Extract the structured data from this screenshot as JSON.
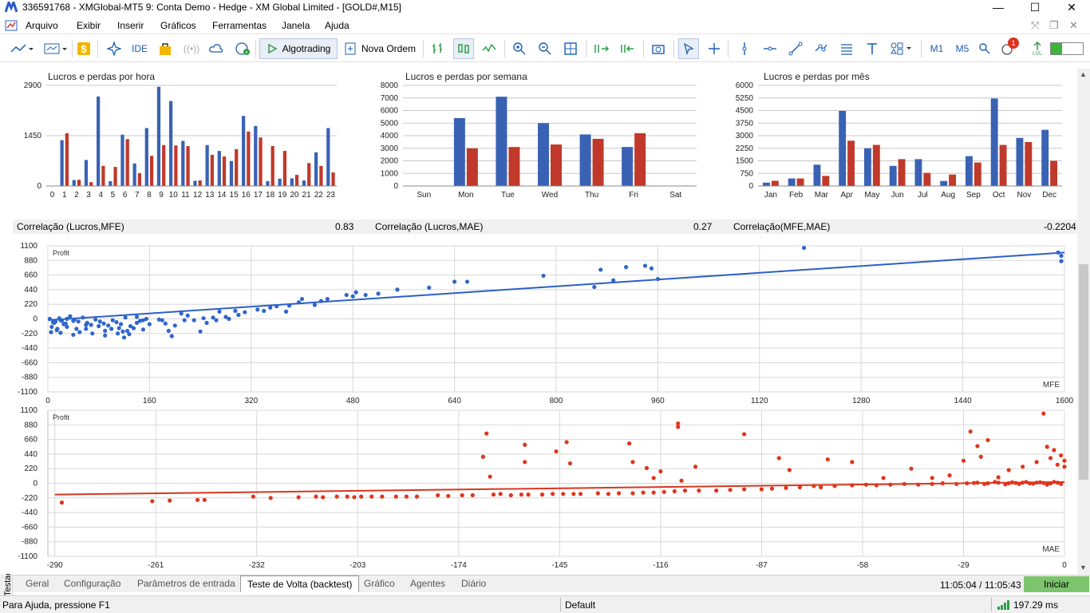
{
  "window": {
    "title": "336591768 - XMGlobal-MT5 9: Conta Demo - Hedge - XM Global Limited - [GOLD#,M15]"
  },
  "menu": [
    "Arquivo",
    "Exibir",
    "Inserir",
    "Gráficos",
    "Ferramentas",
    "Janela",
    "Ajuda"
  ],
  "toolbar": {
    "ide": "IDE",
    "algotrading": "Algotrading",
    "nova_ordem": "Nova Ordem",
    "tf1": "M1",
    "tf2": "M5",
    "notif_count": "1",
    "lvl": "LVL"
  },
  "colors": {
    "blue": "#3a62b4",
    "red": "#c0392b",
    "scatter_blue": "#2f66c9",
    "scatter_red": "#e0351c",
    "start_green": "#7dc56d"
  },
  "side_label": "Testador de Estratégia",
  "correlation": {
    "c1_label": "Correlação (Lucros,MFE)",
    "c1_value": "0.83",
    "c2_label": "Correlação (Lucros,MAE)",
    "c2_value": "0.27",
    "c3_label": "Correlação(MFE,MAE)",
    "c3_value": "-0.2204"
  },
  "chart_data": [
    {
      "type": "bar",
      "title": "Lucros e perdas por hora",
      "categories": [
        "0",
        "1",
        "2",
        "3",
        "4",
        "5",
        "6",
        "7",
        "8",
        "9",
        "10",
        "11",
        "12",
        "13",
        "14",
        "15",
        "16",
        "17",
        "18",
        "19",
        "20",
        "21",
        "22",
        "23"
      ],
      "series": [
        {
          "values": [
            0,
            1320,
            170,
            750,
            2580,
            140,
            1480,
            650,
            1670,
            2860,
            2450,
            1300,
            150,
            1180,
            1010,
            720,
            2020,
            1730,
            140,
            210,
            220,
            160,
            970,
            1670
          ]
        },
        {
          "values": [
            0,
            1520,
            180,
            110,
            580,
            550,
            1350,
            370,
            870,
            1180,
            1170,
            1150,
            160,
            900,
            850,
            1060,
            1570,
            1400,
            1150,
            1010,
            320,
            660,
            580,
            390
          ]
        }
      ],
      "yticks": [
        "0",
        "1450",
        "2900"
      ],
      "ylim": [
        0,
        2900
      ]
    },
    {
      "type": "bar",
      "title": "Lucros e perdas por semana",
      "categories": [
        "Sun",
        "Mon",
        "Tue",
        "Wed",
        "Thu",
        "Fri",
        "Sat"
      ],
      "series": [
        {
          "values": [
            0,
            5400,
            7100,
            5000,
            4100,
            3100,
            0
          ]
        },
        {
          "values": [
            0,
            3000,
            3100,
            3300,
            3750,
            4200,
            0
          ]
        }
      ],
      "yticks": [
        "0",
        "1000",
        "2000",
        "3000",
        "4000",
        "5000",
        "6000",
        "7000",
        "8000"
      ],
      "ylim": [
        0,
        8000
      ]
    },
    {
      "type": "bar",
      "title": "Lucros e perdas por mês",
      "categories": [
        "Jan",
        "Feb",
        "Mar",
        "Apr",
        "May",
        "Jun",
        "Jul",
        "Aug",
        "Sep",
        "Oct",
        "Nov",
        "Dec"
      ],
      "series": [
        {
          "values": [
            200,
            450,
            1270,
            4480,
            2250,
            1200,
            1600,
            300,
            1780,
            5220,
            2870,
            3350
          ]
        },
        {
          "values": [
            310,
            450,
            600,
            2700,
            2450,
            1600,
            780,
            680,
            1400,
            2450,
            2620,
            1500
          ]
        }
      ],
      "yticks": [
        "0",
        "750",
        "1500",
        "2250",
        "3000",
        "3750",
        "4500",
        "5250",
        "6000"
      ],
      "ylim": [
        0,
        6000
      ]
    },
    {
      "type": "scatter",
      "series_label": "Profit",
      "xlabel": "MFE",
      "xticks": [
        "0",
        "160",
        "320",
        "480",
        "640",
        "800",
        "960",
        "1120",
        "1280",
        "1440",
        "1600"
      ],
      "xlim": [
        0,
        1600
      ],
      "yticks": [
        "1100",
        "880",
        "660",
        "440",
        "220",
        "0",
        "-220",
        "-440",
        "-660",
        "-880",
        "-1100"
      ],
      "ylim": [
        -1100,
        1100
      ],
      "trend": [
        [
          0,
          -20
        ],
        [
          1600,
          1000
        ]
      ],
      "points": [
        [
          1590,
          1000
        ],
        [
          1595,
          950
        ],
        [
          1595,
          870
        ],
        [
          1190,
          1070
        ],
        [
          940,
          800
        ],
        [
          910,
          780
        ],
        [
          950,
          760
        ],
        [
          870,
          740
        ],
        [
          960,
          600
        ],
        [
          890,
          580
        ],
        [
          860,
          480
        ],
        [
          780,
          650
        ],
        [
          660,
          560
        ],
        [
          640,
          560
        ],
        [
          600,
          470
        ],
        [
          550,
          440
        ],
        [
          520,
          380
        ],
        [
          500,
          360
        ],
        [
          485,
          400
        ],
        [
          480,
          340
        ],
        [
          470,
          360
        ],
        [
          440,
          300
        ],
        [
          430,
          270
        ],
        [
          420,
          210
        ],
        [
          400,
          300
        ],
        [
          395,
          250
        ],
        [
          380,
          200
        ],
        [
          375,
          110
        ],
        [
          360,
          190
        ],
        [
          350,
          170
        ],
        [
          340,
          120
        ],
        [
          330,
          140
        ],
        [
          310,
          100
        ],
        [
          300,
          60
        ],
        [
          295,
          120
        ],
        [
          285,
          0
        ],
        [
          280,
          30
        ],
        [
          270,
          110
        ],
        [
          265,
          -20
        ],
        [
          260,
          20
        ],
        [
          250,
          -60
        ],
        [
          245,
          10
        ],
        [
          240,
          -190
        ],
        [
          230,
          -20
        ],
        [
          220,
          50
        ],
        [
          215,
          -20
        ],
        [
          210,
          80
        ],
        [
          200,
          -100
        ],
        [
          195,
          -260
        ],
        [
          190,
          -180
        ],
        [
          185,
          -70
        ],
        [
          180,
          -20
        ],
        [
          175,
          -10
        ],
        [
          150,
          -160
        ],
        [
          140,
          30
        ],
        [
          125,
          -180
        ],
        [
          120,
          -280
        ],
        [
          110,
          -220
        ],
        [
          100,
          -150
        ],
        [
          90,
          -180
        ],
        [
          80,
          -110
        ],
        [
          70,
          -220
        ],
        [
          60,
          -90
        ],
        [
          50,
          -200
        ],
        [
          45,
          -150
        ],
        [
          40,
          -240
        ],
        [
          30,
          -120
        ],
        [
          25,
          -80
        ],
        [
          20,
          -210
        ],
        [
          15,
          -150
        ],
        [
          10,
          -60
        ],
        [
          5,
          -200
        ],
        [
          3,
          0
        ],
        [
          8,
          -50
        ],
        [
          12,
          -40
        ],
        [
          18,
          10
        ],
        [
          22,
          -30
        ],
        [
          28,
          -70
        ],
        [
          35,
          40
        ],
        [
          42,
          -10
        ],
        [
          48,
          -40
        ],
        [
          55,
          20
        ],
        [
          62,
          -60
        ],
        [
          68,
          -90
        ],
        [
          75,
          -10
        ],
        [
          82,
          -40
        ],
        [
          88,
          -70
        ],
        [
          95,
          -100
        ],
        [
          102,
          -20
        ],
        [
          108,
          -50
        ],
        [
          115,
          -80
        ],
        [
          122,
          20
        ],
        [
          130,
          -110
        ],
        [
          135,
          -140
        ],
        [
          140,
          -60
        ],
        [
          145,
          -30
        ],
        [
          150,
          -20
        ],
        [
          155,
          0
        ],
        [
          160,
          -80
        ],
        [
          112,
          -140
        ],
        [
          118,
          -190
        ],
        [
          128,
          -230
        ],
        [
          90,
          -250
        ],
        [
          60,
          -150
        ],
        [
          40,
          -30
        ],
        [
          30,
          0
        ],
        [
          20,
          -20
        ],
        [
          14,
          -170
        ],
        [
          6,
          -120
        ]
      ]
    },
    {
      "type": "scatter",
      "series_label": "Profit",
      "xlabel": "MAE",
      "xticks": [
        "-290",
        "-261",
        "-232",
        "-203",
        "-174",
        "-145",
        "-116",
        "-87",
        "-58",
        "-29",
        "0"
      ],
      "xlim": [
        -292,
        0
      ],
      "yticks": [
        "1100",
        "880",
        "660",
        "440",
        "220",
        "0",
        "-220",
        "-440",
        "-660",
        "-880",
        "-1100"
      ],
      "ylim": [
        -1100,
        1100
      ],
      "trend": [
        [
          -290,
          -170
        ],
        [
          0,
          20
        ]
      ],
      "points": [
        [
          -288,
          -290
        ],
        [
          -262,
          -270
        ],
        [
          -257,
          -260
        ],
        [
          -249,
          -250
        ],
        [
          -247,
          -250
        ],
        [
          -233,
          -200
        ],
        [
          -228,
          -220
        ],
        [
          -220,
          -210
        ],
        [
          -215,
          -200
        ],
        [
          -213,
          -210
        ],
        [
          -209,
          -200
        ],
        [
          -206,
          -200
        ],
        [
          -204,
          -210
        ],
        [
          -202,
          -200
        ],
        [
          -199,
          -200
        ],
        [
          -196,
          -200
        ],
        [
          -192,
          -200
        ],
        [
          -189,
          -200
        ],
        [
          -186,
          -200
        ],
        [
          -180,
          -180
        ],
        [
          -177,
          -190
        ],
        [
          -173,
          -180
        ],
        [
          -170,
          -180
        ],
        [
          -164,
          -170
        ],
        [
          -162,
          -160
        ],
        [
          -159,
          -180
        ],
        [
          -156,
          -170
        ],
        [
          -154,
          -170
        ],
        [
          -150,
          -170
        ],
        [
          -147,
          -160
        ],
        [
          -144,
          -160
        ],
        [
          -141,
          -160
        ],
        [
          -139,
          -160
        ],
        [
          -134,
          -150
        ],
        [
          -131,
          -160
        ],
        [
          -128,
          -150
        ],
        [
          -124,
          -150
        ],
        [
          -121,
          -140
        ],
        [
          -118,
          -140
        ],
        [
          -115,
          -130
        ],
        [
          -112,
          -120
        ],
        [
          -109,
          -110
        ],
        [
          -105,
          -110
        ],
        [
          -100,
          -110
        ],
        [
          -96,
          -100
        ],
        [
          -92,
          -90
        ],
        [
          -87,
          -90
        ],
        [
          -84,
          -80
        ],
        [
          -80,
          -70
        ],
        [
          -76,
          -60
        ],
        [
          -72,
          -40
        ],
        [
          -70,
          -60
        ],
        [
          -66,
          -40
        ],
        [
          -61,
          -30
        ],
        [
          -57,
          -20
        ],
        [
          -54,
          -30
        ],
        [
          -50,
          -20
        ],
        [
          -46,
          -10
        ],
        [
          -42,
          -20
        ],
        [
          -38,
          -10
        ],
        [
          -35,
          0
        ],
        [
          -31,
          -10
        ],
        [
          -28,
          0
        ],
        [
          -25,
          10
        ],
        [
          -22,
          0
        ],
        [
          -19,
          10
        ],
        [
          -16,
          0
        ],
        [
          -14,
          5
        ],
        [
          -12,
          10
        ],
        [
          -10,
          0
        ],
        [
          -8,
          10
        ],
        [
          -6,
          5
        ],
        [
          -4,
          0
        ],
        [
          -2,
          10
        ],
        [
          -1,
          -10
        ],
        [
          -3,
          20
        ],
        [
          -5,
          -20
        ],
        [
          -7,
          15
        ],
        [
          -9,
          -5
        ],
        [
          -11,
          20
        ],
        [
          -13,
          -10
        ],
        [
          -15,
          15
        ],
        [
          -17,
          -15
        ],
        [
          -20,
          20
        ],
        [
          -23,
          -10
        ],
        [
          -26,
          5
        ],
        [
          -166,
          750
        ],
        [
          -167,
          400
        ],
        [
          -165,
          100
        ],
        [
          -155,
          580
        ],
        [
          -155,
          320
        ],
        [
          -146,
          480
        ],
        [
          -143,
          620
        ],
        [
          -142,
          300
        ],
        [
          -125,
          600
        ],
        [
          -124,
          320
        ],
        [
          -120,
          230
        ],
        [
          -118,
          80
        ],
        [
          -116,
          180
        ],
        [
          -111,
          900
        ],
        [
          -111,
          850
        ],
        [
          -110,
          40
        ],
        [
          -106,
          250
        ],
        [
          -92,
          740
        ],
        [
          -82,
          380
        ],
        [
          -79,
          200
        ],
        [
          -68,
          360
        ],
        [
          -61,
          320
        ],
        [
          -52,
          80
        ],
        [
          -44,
          220
        ],
        [
          -38,
          80
        ],
        [
          -33,
          120
        ],
        [
          -29,
          340
        ],
        [
          -27,
          780
        ],
        [
          -25,
          560
        ],
        [
          -24,
          400
        ],
        [
          -22,
          650
        ],
        [
          -19,
          90
        ],
        [
          -16,
          200
        ],
        [
          -12,
          250
        ],
        [
          -8,
          320
        ],
        [
          -6,
          1050
        ],
        [
          -5,
          550
        ],
        [
          -4,
          380
        ],
        [
          -3,
          500
        ],
        [
          -2,
          280
        ],
        [
          -1,
          420
        ],
        [
          0,
          340
        ],
        [
          0,
          250
        ]
      ]
    }
  ],
  "tabs": [
    "Geral",
    "Configuração",
    "Parâmetros de entrada",
    "Teste de Volta (backtest)",
    "Gráfico",
    "Agentes",
    "Diário"
  ],
  "active_tab": "Teste de Volta (backtest)",
  "timer": "11:05:04 / 11:05:43",
  "start_button": "Iniciar",
  "status": {
    "help": "Para Ajuda, pressione F1",
    "profile": "Default",
    "ping": "197.29 ms"
  }
}
